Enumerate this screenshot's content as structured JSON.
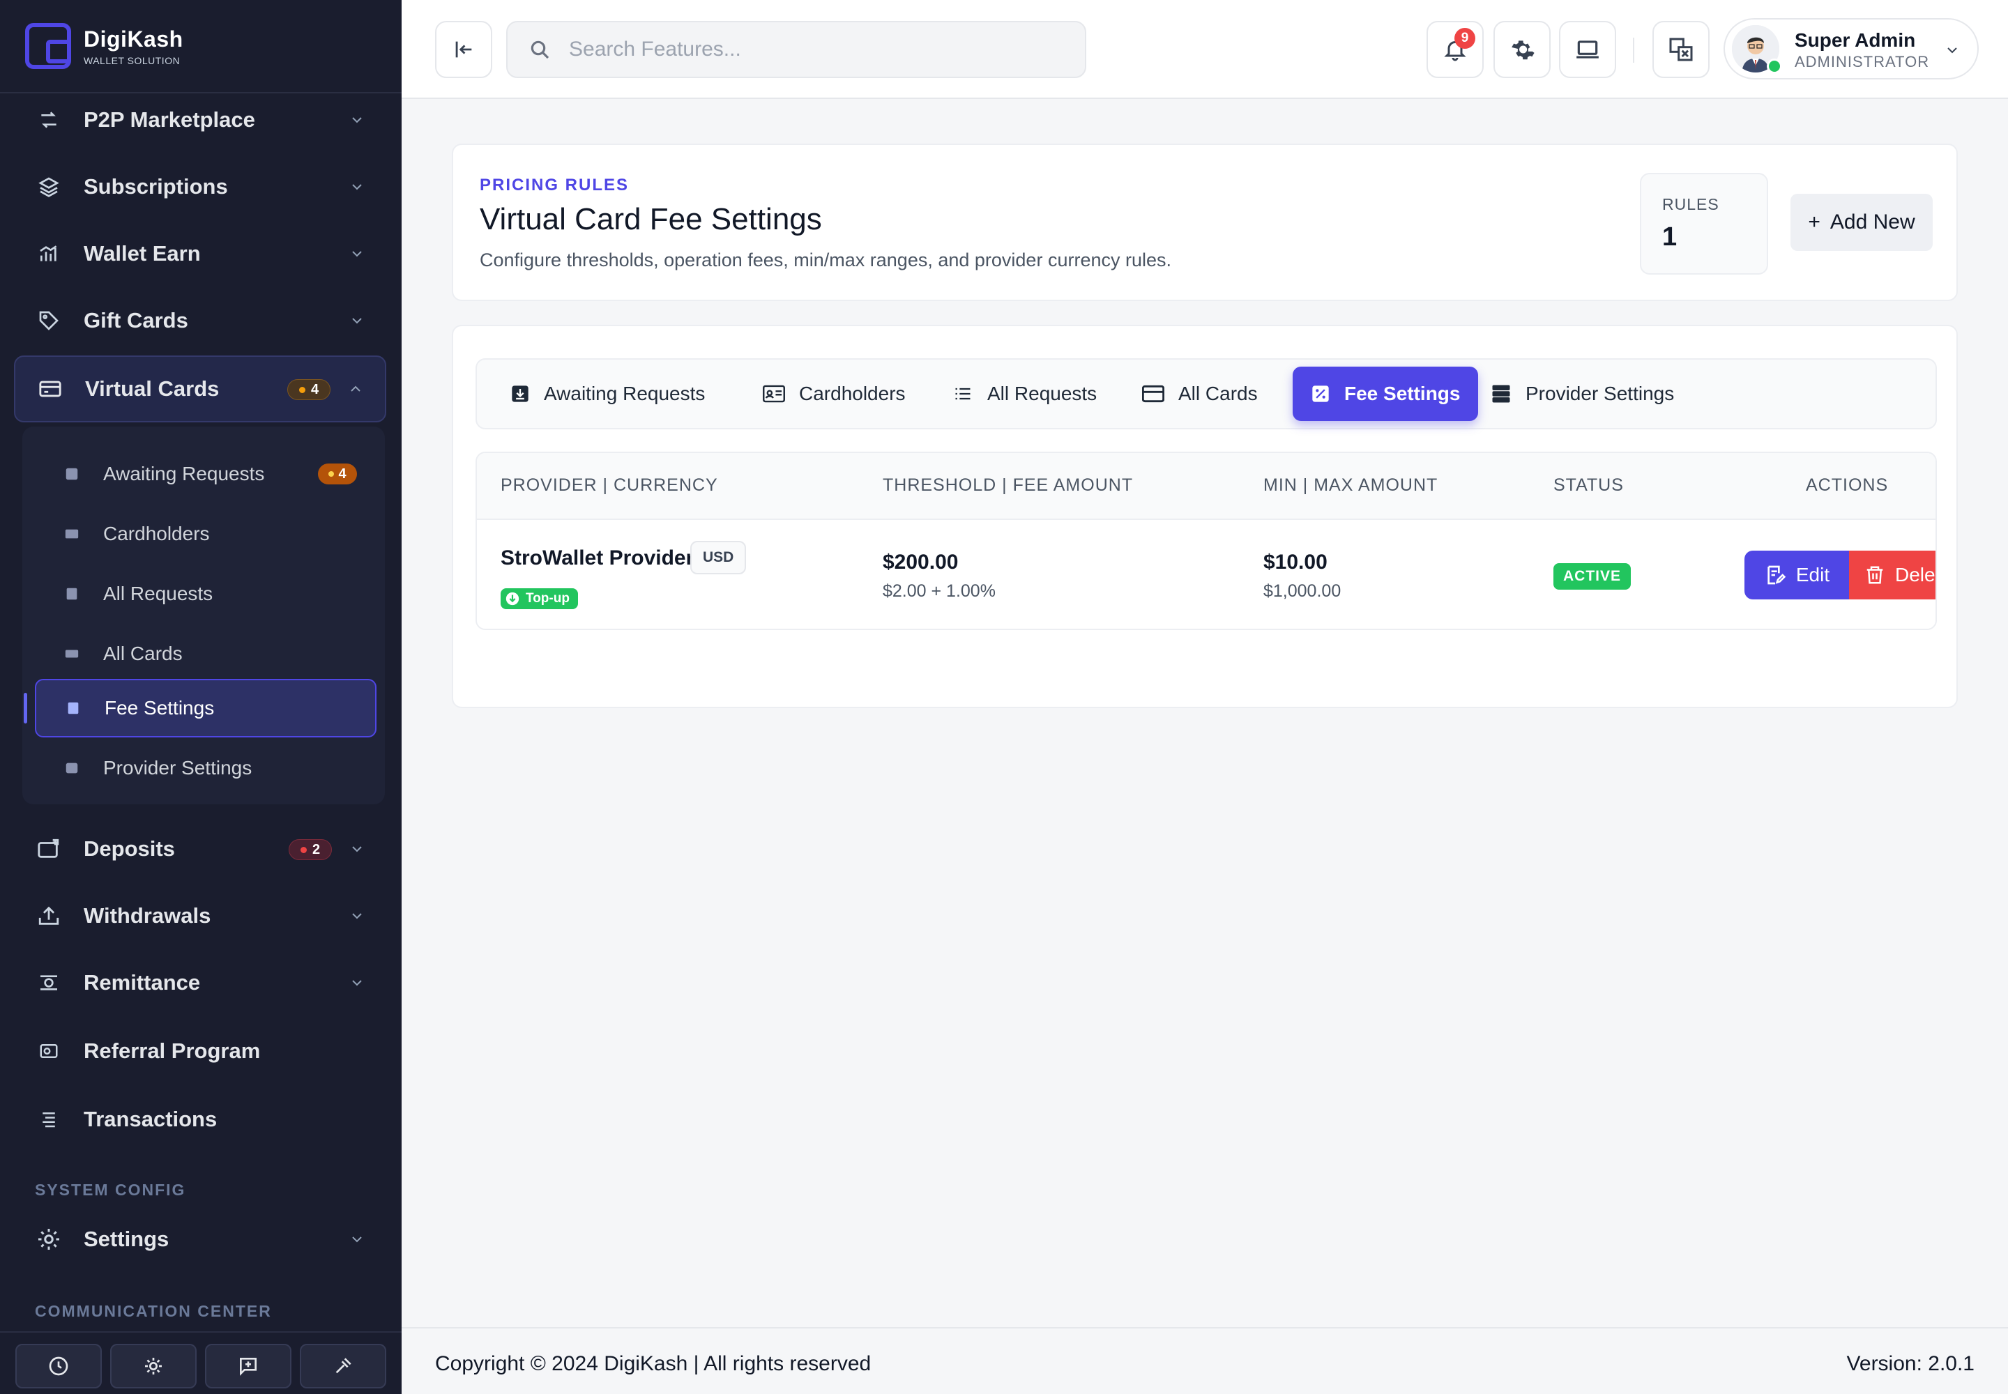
{
  "brand": {
    "name": "DigiKash",
    "tagline": "WALLET SOLUTION"
  },
  "sidebar": {
    "items": [
      {
        "label": "P2P Marketplace",
        "icon": "swap-icon"
      },
      {
        "label": "Subscriptions",
        "icon": "layers-icon"
      },
      {
        "label": "Wallet Earn",
        "icon": "chart-icon"
      },
      {
        "label": "Gift Cards",
        "icon": "tag-icon"
      },
      {
        "label": "Virtual Cards",
        "icon": "card-icon",
        "badge": "4"
      },
      {
        "label": "Deposits",
        "icon": "wallet-plus-icon",
        "badge": "2"
      },
      {
        "label": "Withdrawals",
        "icon": "upload-icon"
      },
      {
        "label": "Remittance",
        "icon": "remit-icon"
      },
      {
        "label": "Referral Program",
        "icon": "referral-icon"
      },
      {
        "label": "Transactions",
        "icon": "list-icon"
      },
      {
        "label": "Settings",
        "icon": "gear-icon"
      }
    ],
    "submenu": [
      {
        "label": "Awaiting Requests",
        "badge": "4"
      },
      {
        "label": "Cardholders"
      },
      {
        "label": "All Requests"
      },
      {
        "label": "All Cards"
      },
      {
        "label": "Fee Settings",
        "active": true
      },
      {
        "label": "Provider Settings"
      }
    ],
    "sections": {
      "system": "SYSTEM CONFIG",
      "communication": "COMMUNICATION CENTER"
    }
  },
  "header": {
    "search_placeholder": "Search Features...",
    "notification_count": "9",
    "user": {
      "name": "Super Admin",
      "role": "ADMINISTRATOR"
    }
  },
  "page": {
    "eyebrow": "PRICING RULES",
    "title": "Virtual Card Fee Settings",
    "description": "Configure thresholds, operation fees, min/max ranges, and provider currency rules.",
    "rules_label": "RULES",
    "rules_count": "1",
    "add_label": "Add New"
  },
  "tabs": [
    {
      "label": "Awaiting Requests"
    },
    {
      "label": "Cardholders"
    },
    {
      "label": "All Requests"
    },
    {
      "label": "All Cards"
    },
    {
      "label": "Fee Settings",
      "active": true
    },
    {
      "label": "Provider Settings"
    }
  ],
  "table": {
    "headers": [
      "PROVIDER | CURRENCY",
      "THRESHOLD | FEE AMOUNT",
      "MIN | MAX AMOUNT",
      "STATUS",
      "ACTIONS"
    ],
    "rows": [
      {
        "provider": "StroWallet Provider",
        "currency": "USD",
        "type": "Top-up",
        "threshold": "$200.00",
        "fee": "$2.00 + 1.00%",
        "min": "$10.00",
        "max": "$1,000.00",
        "status": "ACTIVE",
        "edit_label": "Edit",
        "delete_label": "Delete"
      }
    ]
  },
  "footer": {
    "copyright": "Copyright © 2024 DigiKash | All rights reserved",
    "version": "Version: 2.0.1"
  },
  "colors": {
    "sidebar_bg": "#1a1d2e",
    "accent": "#4f46e5",
    "success": "#22c55e",
    "danger": "#ef4444"
  }
}
